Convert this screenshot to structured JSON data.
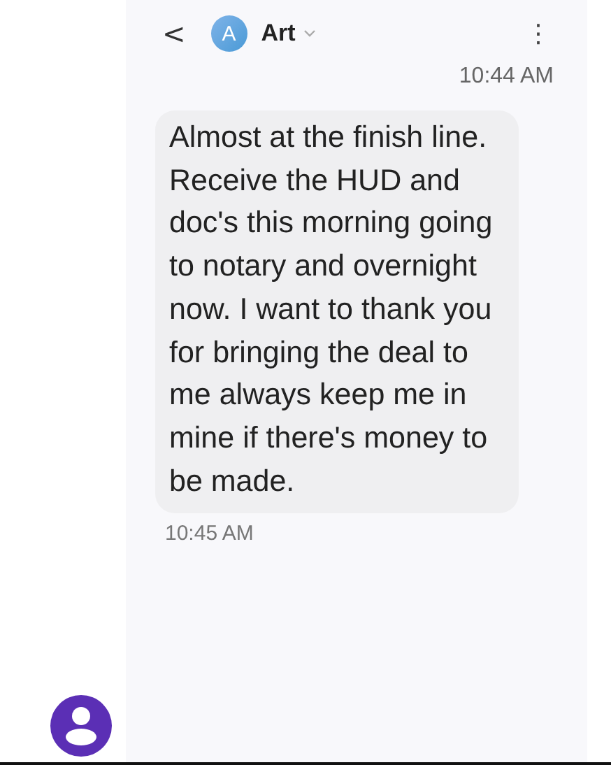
{
  "header": {
    "back": "<",
    "contact_initial": "A",
    "contact_name": "Art",
    "menu": "⋮"
  },
  "messages": [
    {
      "time": "10:44 AM",
      "text": "Almost at the finish line. Receive the HUD and doc's this morning going to notary and overnight now.   I want to thank you for bringing the deal to me always keep me in mine if there's money to be made.",
      "sent_time": "10:45 AM"
    }
  ]
}
